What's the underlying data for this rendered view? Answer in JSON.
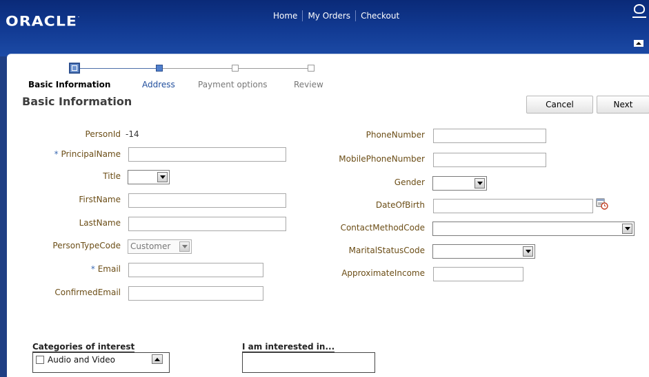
{
  "header": {
    "logo": "ORACLE",
    "nav": [
      "Home",
      "My Orders",
      "Checkout"
    ]
  },
  "train": {
    "steps": [
      {
        "label": "Basic Information",
        "state": "current"
      },
      {
        "label": "Address",
        "state": "next"
      },
      {
        "label": "Payment options",
        "state": "disabled"
      },
      {
        "label": "Review",
        "state": "disabled"
      }
    ]
  },
  "page": {
    "title": "Basic Information",
    "cancel_label": "Cancel",
    "next_label": "Next"
  },
  "form_left": {
    "person_id_label": "PersonId",
    "person_id_value": "-14",
    "principal_name_label": "PrincipalName",
    "required_mark": "*",
    "title_label": "Title",
    "first_name_label": "FirstName",
    "last_name_label": "LastName",
    "person_type_label": "PersonTypeCode",
    "person_type_value": "Customer",
    "email_label": "Email",
    "confirmed_email_label": "ConfirmedEmail"
  },
  "form_right": {
    "phone_label": "PhoneNumber",
    "mobile_label": "MobilePhoneNumber",
    "gender_label": "Gender",
    "dob_label": "DateOfBirth",
    "contact_method_label": "ContactMethodCode",
    "marital_label": "MaritalStatusCode",
    "income_label": "ApproximateIncome"
  },
  "interests": {
    "categories_heading": "Categories of interest",
    "categories": [
      {
        "label": "Audio and Video",
        "checked": false
      }
    ],
    "interested_heading": "I am interested in..."
  },
  "colors": {
    "header_blue": "#123b94",
    "label_brown": "#6b4d16",
    "link_blue": "#1f4d9c",
    "required_blue": "#3d6bb3"
  },
  "icons": {
    "calendar": "calendar-clock-icon",
    "dropdown": "chevron-down-icon",
    "scroll": "scroll-up-icon",
    "user": "user-icon",
    "collapse": "collapse-up-icon"
  }
}
